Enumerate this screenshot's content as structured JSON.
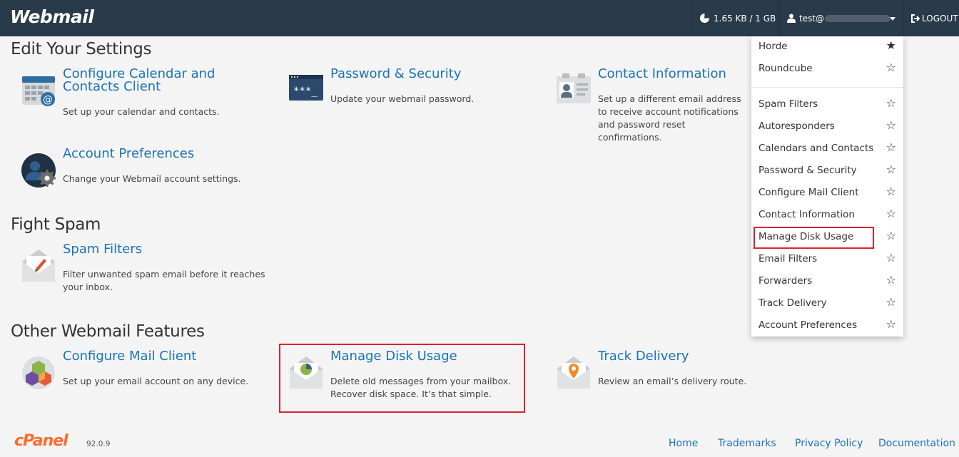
{
  "header": {
    "brand": "Webmail",
    "disk_usage": "1.65 KB / 1 GB",
    "user_label": "test@",
    "logout": "LOGOUT"
  },
  "sections": {
    "settings_title": "Edit Your Settings",
    "spam_title": "Fight Spam",
    "other_title": "Other Webmail Features"
  },
  "tiles": {
    "calendar": {
      "title": "Configure Calendar and Contacts Client",
      "desc": "Set up your calendar and contacts."
    },
    "password": {
      "title": "Password & Security",
      "desc": "Update your webmail password."
    },
    "contact": {
      "title": "Contact Information",
      "desc": "Set up a different email address to receive account notifications and password reset confirmations."
    },
    "account": {
      "title": "Account Preferences",
      "desc": "Change your Webmail account settings."
    },
    "spam": {
      "title": "Spam Filters",
      "desc": "Filter unwanted spam email before it reaches your inbox."
    },
    "mailclient": {
      "title": "Configure Mail Client",
      "desc": "Set up your email account on any device."
    },
    "disk": {
      "title": "Manage Disk Usage",
      "desc": "Delete old messages from your mailbox. Recover disk space. It’s that simple."
    },
    "track": {
      "title": "Track Delivery",
      "desc": "Review an email’s delivery route."
    }
  },
  "menu": {
    "items": [
      {
        "label": "Horde",
        "star": "★"
      },
      {
        "label": "Roundcube",
        "star": "☆"
      },
      {
        "label": "Spam Filters",
        "star": "☆"
      },
      {
        "label": "Autoresponders",
        "star": "☆"
      },
      {
        "label": "Calendars and Contacts",
        "star": "☆"
      },
      {
        "label": "Password & Security",
        "star": "☆"
      },
      {
        "label": "Configure Mail Client",
        "star": "☆"
      },
      {
        "label": "Contact Information",
        "star": "☆"
      },
      {
        "label": "Manage Disk Usage",
        "star": "☆"
      },
      {
        "label": "Email Filters",
        "star": "☆"
      },
      {
        "label": "Forwarders",
        "star": "☆"
      },
      {
        "label": "Track Delivery",
        "star": "☆"
      },
      {
        "label": "Account Preferences",
        "star": "☆"
      }
    ]
  },
  "footer": {
    "brand": "cPanel",
    "version": "92.0.9",
    "links": [
      "Home",
      "Trademarks",
      "Privacy Policy",
      "Documentation"
    ]
  },
  "colors": {
    "header_bg": "#293a4a",
    "link": "#1a73b8",
    "highlight": "#d9232e",
    "cpanel": "#ff6c2c"
  },
  "icons": [
    "pie-chart-icon",
    "user-icon",
    "logout-icon",
    "calendar-icon",
    "password-icon",
    "contact-card-icon",
    "account-prefs-icon",
    "spam-envelope-icon",
    "mail-client-icon",
    "disk-envelope-icon",
    "track-envelope-icon",
    "star-icon"
  ]
}
